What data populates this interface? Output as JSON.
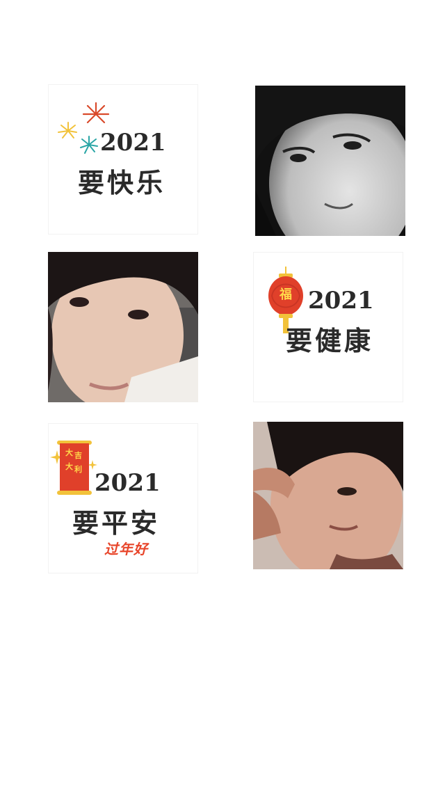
{
  "tiles": [
    {
      "kind": "text",
      "year": "2021",
      "wish": "要快乐"
    },
    {
      "kind": "photo",
      "description_icon": "portrait-photo-icon"
    },
    {
      "kind": "photo",
      "description_icon": "portrait-photo-icon"
    },
    {
      "kind": "text",
      "year": "2021",
      "wish": "要健康",
      "lantern_char": "福"
    },
    {
      "kind": "text",
      "year": "2021",
      "wish": "要平安",
      "scroll_chars": [
        "大",
        "吉",
        "大",
        "利"
      ],
      "tag": "过年好"
    },
    {
      "kind": "photo",
      "description_icon": "portrait-photo-icon"
    }
  ],
  "colors": {
    "text": "#2a2a2a",
    "firework_red": "#d94a2b",
    "firework_yellow": "#f2c23a",
    "firework_teal": "#2aa6a6",
    "lantern_red": "#e0402a",
    "gold": "#f2c23a",
    "tag_red": "#e8462b"
  }
}
